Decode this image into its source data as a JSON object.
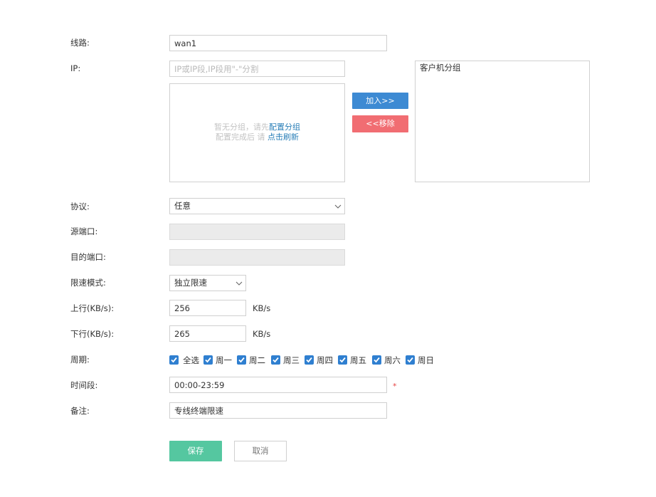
{
  "form": {
    "line_label": "线路:",
    "line_value": "wan1",
    "ip_label": "IP:",
    "ip_placeholder": "IP或IP段,IP段用\"-\"分割",
    "group_empty_text": "暂无分组，请先",
    "group_config_link": "配置分组",
    "group_refresh_text": "配置完成后 请",
    "group_refresh_link": "点击刷新",
    "add_button": "加入>>",
    "remove_button": "<<移除",
    "client_group_title": "客户机分组",
    "protocol_label": "协议:",
    "protocol_value": "任意",
    "src_port_label": "源端口:",
    "dst_port_label": "目的端口:",
    "limit_mode_label": "限速模式:",
    "limit_mode_value": "独立限速",
    "up_label": "上行(KB/s):",
    "up_value": "256",
    "up_unit": "KB/s",
    "down_label": "下行(KB/s):",
    "down_value": "265",
    "down_unit": "KB/s",
    "period_label": "周期:",
    "days": [
      {
        "label": "全选",
        "checked": true
      },
      {
        "label": "周一",
        "checked": true
      },
      {
        "label": "周二",
        "checked": true
      },
      {
        "label": "周三",
        "checked": true
      },
      {
        "label": "周四",
        "checked": true
      },
      {
        "label": "周五",
        "checked": true
      },
      {
        "label": "周六",
        "checked": true
      },
      {
        "label": "周日",
        "checked": true
      }
    ],
    "time_label": "时间段:",
    "time_value": "00:00-23:59",
    "required_mark": "*",
    "note_label": "备注:",
    "note_value": "专线终端限速",
    "save_button": "保存",
    "cancel_button": "取消"
  },
  "colors": {
    "add": "#3d8ad3",
    "remove": "#f16d72",
    "save": "#55c7a0",
    "checkbox": "#2f7fd0",
    "link": "#2a7fb8"
  }
}
